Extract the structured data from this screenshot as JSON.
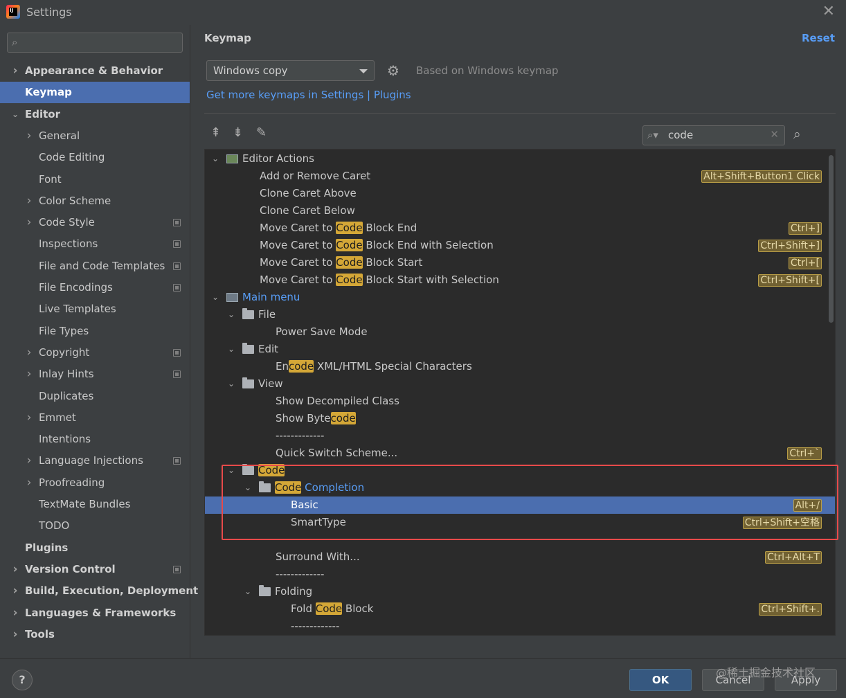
{
  "window": {
    "title": "Settings",
    "app_icon_text": "IJ"
  },
  "sidebar": {
    "search_placeholder": "",
    "items": [
      {
        "label": "Appearance & Behavior",
        "bold": true,
        "chevron": true,
        "indent": 0
      },
      {
        "label": "Keymap",
        "bold": true,
        "chevron": false,
        "indent": 0,
        "selected": true
      },
      {
        "label": "Editor",
        "bold": true,
        "chevron": true,
        "expanded": true,
        "indent": 0
      },
      {
        "label": "General",
        "chevron": true,
        "indent": 1
      },
      {
        "label": "Code Editing",
        "indent": 1
      },
      {
        "label": "Font",
        "indent": 1
      },
      {
        "label": "Color Scheme",
        "chevron": true,
        "indent": 1
      },
      {
        "label": "Code Style",
        "chevron": true,
        "indent": 1,
        "project": true
      },
      {
        "label": "Inspections",
        "indent": 1,
        "project": true
      },
      {
        "label": "File and Code Templates",
        "indent": 1,
        "project": true
      },
      {
        "label": "File Encodings",
        "indent": 1,
        "project": true
      },
      {
        "label": "Live Templates",
        "indent": 1
      },
      {
        "label": "File Types",
        "indent": 1
      },
      {
        "label": "Copyright",
        "chevron": true,
        "indent": 1,
        "project": true
      },
      {
        "label": "Inlay Hints",
        "chevron": true,
        "indent": 1,
        "project": true
      },
      {
        "label": "Duplicates",
        "indent": 1
      },
      {
        "label": "Emmet",
        "chevron": true,
        "indent": 1
      },
      {
        "label": "Intentions",
        "indent": 1
      },
      {
        "label": "Language Injections",
        "chevron": true,
        "indent": 1,
        "project": true
      },
      {
        "label": "Proofreading",
        "chevron": true,
        "indent": 1
      },
      {
        "label": "TextMate Bundles",
        "indent": 1
      },
      {
        "label": "TODO",
        "indent": 1
      },
      {
        "label": "Plugins",
        "bold": true,
        "indent": 0
      },
      {
        "label": "Version Control",
        "bold": true,
        "chevron": true,
        "indent": 0,
        "project": true
      },
      {
        "label": "Build, Execution, Deployment",
        "bold": true,
        "chevron": true,
        "indent": 0
      },
      {
        "label": "Languages & Frameworks",
        "bold": true,
        "chevron": true,
        "indent": 0
      },
      {
        "label": "Tools",
        "bold": true,
        "chevron": true,
        "indent": 0
      }
    ]
  },
  "main": {
    "title": "Keymap",
    "reset_label": "Reset",
    "keymap_select_value": "Windows copy",
    "based_on": "Based on Windows keymap",
    "more_link": "Get more keymaps in Settings | Plugins",
    "filter_value": "code",
    "highlight_color": "#d4a737",
    "selection_color": "#4b6eaf",
    "annotation_color": "#e84a4a"
  },
  "tree": [
    {
      "level": 0,
      "toggle": "down",
      "icon": "editor",
      "parts": [
        [
          "Editor Actions",
          false
        ]
      ]
    },
    {
      "level": 2,
      "parts": [
        [
          "Add or Remove Caret",
          false
        ]
      ],
      "shortcut": "Alt+Shift+Button1 Click"
    },
    {
      "level": 2,
      "parts": [
        [
          "Clone Caret Above",
          false
        ]
      ]
    },
    {
      "level": 2,
      "parts": [
        [
          "Clone Caret Below",
          false
        ]
      ]
    },
    {
      "level": 2,
      "parts": [
        [
          "Move Caret to ",
          false
        ],
        [
          "Code",
          true
        ],
        [
          " Block End",
          false
        ]
      ],
      "shortcut": "Ctrl+]"
    },
    {
      "level": 2,
      "parts": [
        [
          "Move Caret to ",
          false
        ],
        [
          "Code",
          true
        ],
        [
          " Block End with Selection",
          false
        ]
      ],
      "shortcut": "Ctrl+Shift+]"
    },
    {
      "level": 2,
      "parts": [
        [
          "Move Caret to ",
          false
        ],
        [
          "Code",
          true
        ],
        [
          " Block Start",
          false
        ]
      ],
      "shortcut": "Ctrl+["
    },
    {
      "level": 2,
      "parts": [
        [
          "Move Caret to ",
          false
        ],
        [
          "Code",
          true
        ],
        [
          " Block Start with Selection",
          false
        ]
      ],
      "shortcut": "Ctrl+Shift+["
    },
    {
      "level": 0,
      "toggle": "down",
      "icon": "menu",
      "link": true,
      "parts": [
        [
          "Main menu",
          false
        ]
      ]
    },
    {
      "level": 1,
      "toggle": "down",
      "icon": "folder",
      "parts": [
        [
          "File",
          false
        ]
      ]
    },
    {
      "level": 3,
      "parts": [
        [
          "Power Save Mode",
          false
        ]
      ]
    },
    {
      "level": 1,
      "toggle": "down",
      "icon": "folder",
      "parts": [
        [
          "Edit",
          false
        ]
      ]
    },
    {
      "level": 3,
      "parts": [
        [
          "En",
          false
        ],
        [
          "code",
          true
        ],
        [
          " XML/HTML Special Characters",
          false
        ]
      ]
    },
    {
      "level": 1,
      "toggle": "down",
      "icon": "folder",
      "parts": [
        [
          "View",
          false
        ]
      ]
    },
    {
      "level": 3,
      "parts": [
        [
          "Show Decompiled Class",
          false
        ]
      ]
    },
    {
      "level": 3,
      "parts": [
        [
          "Show Byte",
          false
        ],
        [
          "code",
          true
        ]
      ]
    },
    {
      "level": 3,
      "parts": [
        [
          "-------------",
          false
        ]
      ]
    },
    {
      "level": 3,
      "parts": [
        [
          "Quick Switch Scheme...",
          false
        ]
      ],
      "shortcut": "Ctrl+`"
    },
    {
      "level": 1,
      "toggle": "down",
      "icon": "folder",
      "parts": [
        [
          "Code",
          true
        ]
      ]
    },
    {
      "level": 2,
      "toggle": "down",
      "icon": "folder",
      "link": true,
      "parts": [
        [
          "Code",
          true
        ],
        [
          " Completion",
          false
        ]
      ]
    },
    {
      "level": 4,
      "parts": [
        [
          "Basic",
          false
        ]
      ],
      "shortcut": "Alt+/",
      "selected": true
    },
    {
      "level": 4,
      "parts": [
        [
          "SmartType",
          false
        ]
      ],
      "shortcut": "Ctrl+Shift+空格"
    },
    {
      "level": 3,
      "parts": [
        [
          "",
          false
        ]
      ]
    },
    {
      "level": 3,
      "parts": [
        [
          "Surround With...",
          false
        ]
      ],
      "shortcut": "Ctrl+Alt+T"
    },
    {
      "level": 3,
      "parts": [
        [
          "-------------",
          false
        ]
      ]
    },
    {
      "level": 2,
      "toggle": "down",
      "icon": "folder",
      "parts": [
        [
          "Folding",
          false
        ]
      ]
    },
    {
      "level": 4,
      "parts": [
        [
          "Fold ",
          false
        ],
        [
          "Code",
          true
        ],
        [
          " Block",
          false
        ]
      ],
      "shortcut": "Ctrl+Shift+."
    },
    {
      "level": 4,
      "parts": [
        [
          "-------------",
          false
        ]
      ]
    }
  ],
  "buttons": {
    "ok": "OK",
    "cancel": "Cancel",
    "apply": "Apply",
    "help": "?"
  },
  "watermark": "@稀土掘金技术社区"
}
